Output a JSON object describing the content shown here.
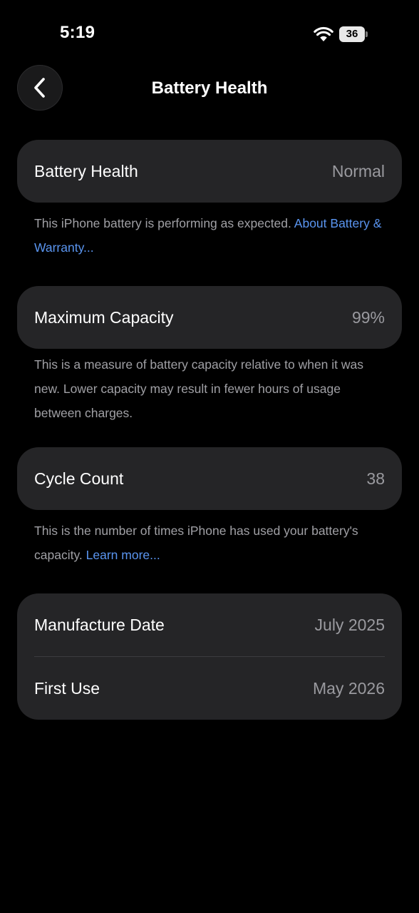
{
  "status_bar": {
    "time": "5:19",
    "battery_level": "36"
  },
  "nav": {
    "title": "Battery Health"
  },
  "battery_health": {
    "label": "Battery Health",
    "value": "Normal",
    "footnote": "This iPhone battery is performing as expected.",
    "link": "About Battery & Warranty..."
  },
  "maximum_capacity": {
    "label": "Maximum Capacity",
    "value": "99%",
    "footnote": "This is a measure of battery capacity relative to when it was new. Lower capacity may result in fewer hours of usage between charges."
  },
  "cycle_count": {
    "label": "Cycle Count",
    "value": "38",
    "footnote": "This is the number of times iPhone has used your battery's capacity.",
    "link": "Learn more..."
  },
  "dates": {
    "manufacture_label": "Manufacture Date",
    "manufacture_value": "July 2025",
    "first_use_label": "First Use",
    "first_use_value": "May 2026"
  },
  "colors": {
    "background": "#000000",
    "card": "#252527",
    "secondary_text": "#9a9a9f",
    "link": "#5a95f0"
  }
}
